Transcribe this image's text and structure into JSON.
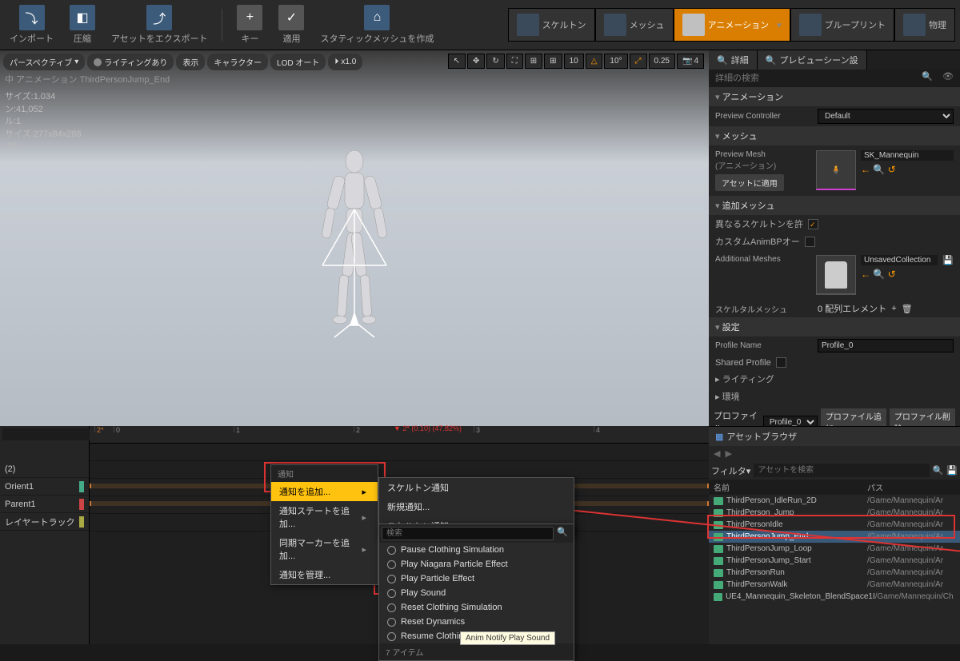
{
  "toolbar": {
    "import": "インポート",
    "compress": "圧縮",
    "export": "アセットをエクスポート",
    "key": "キー",
    "apply": "適用",
    "staticmesh": "スタティックメッシュを作成"
  },
  "modes": {
    "skeleton": "スケルトン",
    "mesh": "メッシュ",
    "anim": "アニメーション",
    "bp": "ブループリント",
    "physics": "物理"
  },
  "viewport": {
    "persp": "パースペクティブ",
    "lit": "ライティングあり",
    "show": "表示",
    "char": "キャラクター",
    "lod": "LOD オート",
    "speed": "x1.0",
    "info": "中 アニメーション ThirdPersonJump_End",
    "size": "サイズ:1.034",
    "tris": "ン:41,052",
    "lodlv": "ル:1",
    "screen": "サイズ:277x84x288",
    "rate": ":25",
    "num1": "10",
    "num2": "10°",
    "num3": "0.25",
    "num4": "4"
  },
  "detail": {
    "tab1": "詳細",
    "tab2": "プレビューシーン設",
    "search": "詳細の検索",
    "sect_anim": "アニメーション",
    "preview_ctrl": "Preview Controller",
    "default": "Default",
    "sect_mesh": "メッシュ",
    "preview_mesh": "Preview Mesh",
    "preview_mesh_jp": "(アニメーション)",
    "sk": "SK_Mannequin",
    "apply_asset": "アセットに適用",
    "sect_add": "追加メッシュ",
    "allow_diff": "異なるスケルトンを許",
    "custom_bp": "カスタムAnimBPオー",
    "add_meshes": "Additional Meshes",
    "unsaved": "UnsavedCollection",
    "skel_mesh": "スケルタルメッシュ",
    "zero_el": "0 配列エレメント",
    "sect_set": "設定",
    "profile_name": "Profile Name",
    "profile0": "Profile_0",
    "shared": "Shared Profile",
    "sect_light": "ライティング",
    "sect_env": "環境",
    "profile_lbl": "プロファイル",
    "add_profile": "プロファイル追加",
    "del_profile": "プロファイル削除"
  },
  "timeline": {
    "pos": "2* (0.10) (47.82%)",
    "t2s": "2*",
    "tracks": [
      "(2)",
      "Orient1",
      "Parent1",
      "レイヤートラック"
    ]
  },
  "asset_browser": {
    "tab": "アセットブラウザ",
    "filter": "フィルタ▾",
    "search": "アセットを検索",
    "col_name": "名前",
    "col_path": "パス",
    "rows": [
      {
        "n": "ThirdPerson_IdleRun_2D",
        "p": "/Game/Mannequin/Ar"
      },
      {
        "n": "ThirdPerson_Jump",
        "p": "/Game/Mannequin/Ar"
      },
      {
        "n": "ThirdPersonIdle",
        "p": "/Game/Mannequin/Ar"
      },
      {
        "n": "ThirdPersonJump_End",
        "p": "/Game/Mannequin/Ar"
      },
      {
        "n": "ThirdPersonJump_Loop",
        "p": "/Game/Mannequin/Ar"
      },
      {
        "n": "ThirdPersonJump_Start",
        "p": "/Game/Mannequin/Ar"
      },
      {
        "n": "ThirdPersonRun",
        "p": "/Game/Mannequin/Ar"
      },
      {
        "n": "ThirdPersonWalk",
        "p": "/Game/Mannequin/Ar"
      },
      {
        "n": "UE4_Mannequin_Skeleton_BlendSpace1I",
        "p": "/Game/Mannequin/Ch"
      }
    ]
  },
  "ctx1": {
    "hdr": "通知",
    "add_notify": "通知を追加...",
    "add_state": "通知ステートを追加...",
    "add_sync": "同期マーカーを追加...",
    "manage": "通知を管理..."
  },
  "ctx2": {
    "skel": "スケルトン通知",
    "new": "新規通知...",
    "skel2": "スケルトン通知"
  },
  "ctx3": {
    "search": "検索",
    "items": [
      "Pause Clothing Simulation",
      "Play Niagara Particle Effect",
      "Play Particle Effect",
      "Play Sound",
      "Reset Clothing Simulation",
      "Reset Dynamics",
      "Resume Clothing Simulation"
    ],
    "footer": "7 アイテム",
    "tooltip": "Anim Notify Play Sound"
  }
}
